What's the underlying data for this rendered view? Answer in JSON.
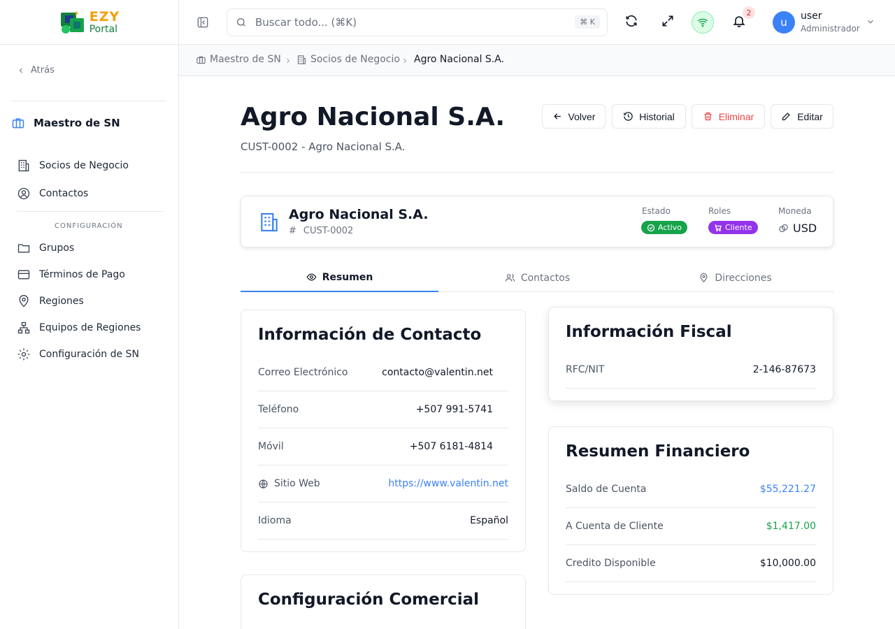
{
  "brand": {
    "line1": "EZY",
    "line2": "Portal"
  },
  "sidebar": {
    "back_label": "Atrás",
    "module_title": "Maestro de SN",
    "items": [
      {
        "label": "Socios de Negocio",
        "icon": "building-icon"
      },
      {
        "label": "Contactos",
        "icon": "user-circle-icon"
      }
    ],
    "section_title": "CONFIGURACIÓN",
    "config_items": [
      {
        "label": "Grupos",
        "icon": "folder-icon"
      },
      {
        "label": "Términos de Pago",
        "icon": "credit-card-icon"
      },
      {
        "label": "Regiones",
        "icon": "map-pin-icon"
      },
      {
        "label": "Equipos de Regiones",
        "icon": "network-icon"
      },
      {
        "label": "Configuración de SN",
        "icon": "gear-icon"
      }
    ]
  },
  "topbar": {
    "search_placeholder": "Buscar todo... (⌘K)",
    "search_shortcut": "⌘ K",
    "notification_count": "2",
    "user": {
      "initial": "u",
      "name": "user",
      "role": "Administrador"
    }
  },
  "breadcrumb": [
    "Maestro de SN",
    "Socios de Negocio",
    "Agro Nacional S.A."
  ],
  "header": {
    "title": "Agro Nacional S.A.",
    "subtitle": "CUST-0002 - Agro Nacional S.A.",
    "buttons": {
      "back": "Volver",
      "history": "Historial",
      "delete": "Eliminar",
      "edit": "Editar"
    }
  },
  "summary": {
    "name": "Agro Nacional S.A.",
    "code": "CUST-0002",
    "estado_label": "Estado",
    "estado_value": "Activo",
    "roles_label": "Roles",
    "roles_value": "Cliente",
    "moneda_label": "Moneda",
    "moneda_value": "USD"
  },
  "tabs": [
    "Resumen",
    "Contactos",
    "Direcciones"
  ],
  "contact_info": {
    "title": "Información de Contacto",
    "rows": [
      {
        "label": "Correo Electrónico",
        "value": "contacto@valentin.net"
      },
      {
        "label": "Teléfono",
        "value": "+507 991-5741"
      },
      {
        "label": "Móvil",
        "value": "+507 6181-4814"
      },
      {
        "label": "Sitio Web",
        "value": "https://www.valentin.net"
      },
      {
        "label": "Idioma",
        "value": "Español"
      }
    ]
  },
  "fiscal_info": {
    "title": "Información Fiscal",
    "rows": [
      {
        "label": "RFC/NIT",
        "value": "2-146-87673"
      }
    ]
  },
  "financial_summary": {
    "title": "Resumen Financiero",
    "rows": [
      {
        "label": "Saldo de Cuenta",
        "value": "$55,221.27"
      },
      {
        "label": "A Cuenta de Cliente",
        "value": "$1,417.00"
      },
      {
        "label": "Credito Disponible",
        "value": "$10,000.00"
      }
    ]
  },
  "commercial_config": {
    "title": "Configuración Comercial"
  },
  "colors": {
    "accent": "#3b82f6",
    "success": "#16a34a",
    "danger": "#ef4444",
    "purple": "#9333ea"
  }
}
